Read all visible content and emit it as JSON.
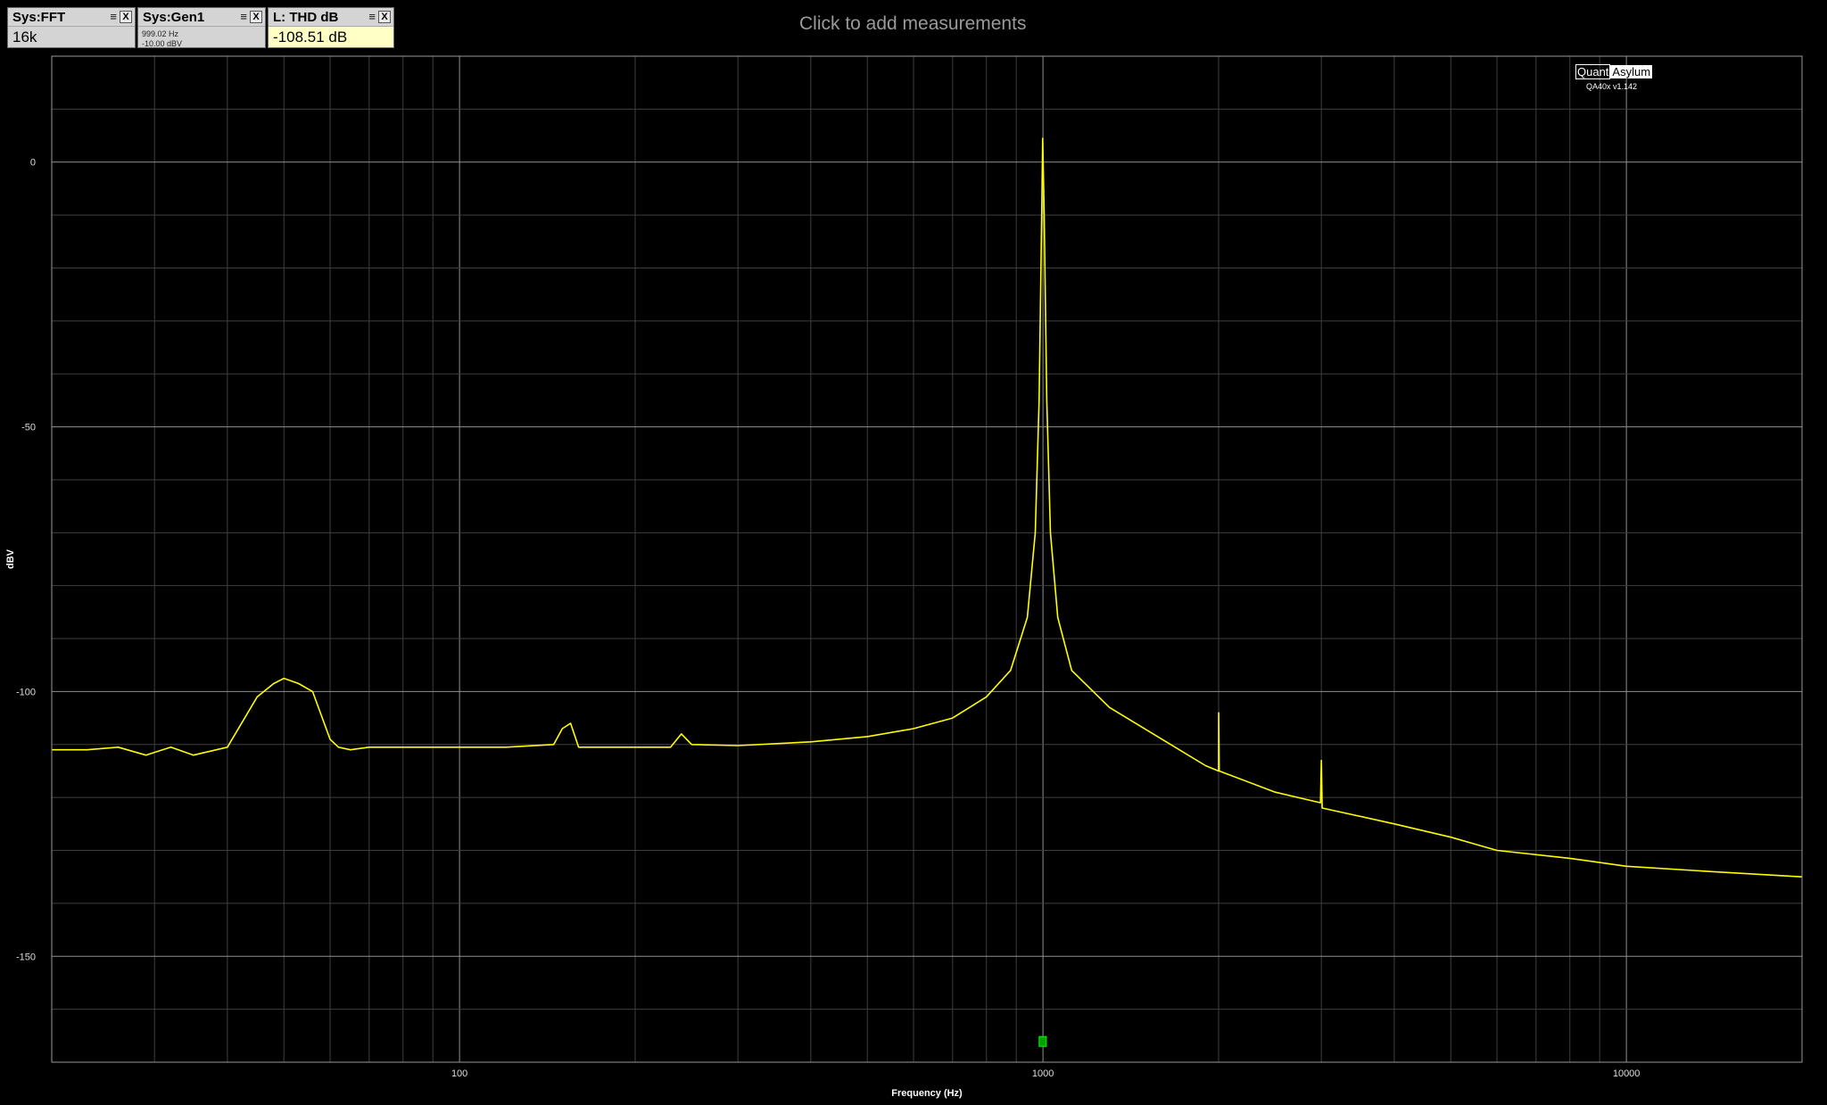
{
  "widgets": [
    {
      "title": "Sys:FFT",
      "value": "16k",
      "lines": [],
      "menu_icon": "hamburger-icon",
      "close_label": "X"
    },
    {
      "title": "Sys:Gen1",
      "value": "",
      "lines": [
        "999.02 Hz",
        "-10.00 dBV"
      ],
      "menu_icon": "hamburger-icon",
      "close_label": "X"
    },
    {
      "title": "L: THD dB",
      "value": "-108.51 dB",
      "lines": [],
      "menu_icon": "hamburger-icon",
      "close_label": "X"
    }
  ],
  "add_measurements": "Click to add measurements",
  "logo": {
    "part1": "Quant",
    "part2": "Asylum",
    "version": "QA40x v1.142"
  },
  "colors": {
    "trace": "#ffff00",
    "grid": "#3f3f3f",
    "grid_major": "#909090",
    "marker": "#00a000",
    "background": "#000000"
  },
  "chart_data": {
    "type": "line",
    "title": "",
    "xlabel": "Frequency (Hz)",
    "ylabel": "dBV",
    "x_scale": "log",
    "xlim": [
      20,
      20000
    ],
    "ylim": [
      -170,
      20
    ],
    "x_ticks": [
      100,
      1000,
      10000
    ],
    "x_tick_labels": [
      "100",
      "1000",
      "10000"
    ],
    "y_ticks": [
      0,
      -50,
      -100,
      -150
    ],
    "y_tick_labels": [
      "0",
      "-50",
      "-100",
      "-150"
    ],
    "grid": true,
    "series": [
      {
        "color": "#ffff00",
        "points": [
          [
            20,
            -111
          ],
          [
            23,
            -111
          ],
          [
            26,
            -110.5
          ],
          [
            29,
            -112
          ],
          [
            32,
            -110.5
          ],
          [
            35,
            -112
          ],
          [
            40,
            -110.5
          ],
          [
            45,
            -101
          ],
          [
            48,
            -98.5
          ],
          [
            50,
            -97.5
          ],
          [
            53,
            -98.5
          ],
          [
            56,
            -100
          ],
          [
            60,
            -109
          ],
          [
            62,
            -110.5
          ],
          [
            65,
            -111
          ],
          [
            70,
            -110.5
          ],
          [
            80,
            -110.5
          ],
          [
            90,
            -110.5
          ],
          [
            100,
            -110.5
          ],
          [
            120,
            -110.5
          ],
          [
            145,
            -110
          ],
          [
            150,
            -107
          ],
          [
            155,
            -106
          ],
          [
            160,
            -110.5
          ],
          [
            200,
            -110.5
          ],
          [
            230,
            -110.5
          ],
          [
            240,
            -108
          ],
          [
            250,
            -110
          ],
          [
            300,
            -110.2
          ],
          [
            400,
            -109.5
          ],
          [
            500,
            -108.5
          ],
          [
            600,
            -107
          ],
          [
            700,
            -105
          ],
          [
            800,
            -101
          ],
          [
            880,
            -96
          ],
          [
            940,
            -86
          ],
          [
            970,
            -70
          ],
          [
            985,
            -45
          ],
          [
            995,
            -10
          ],
          [
            999.02,
            4.5
          ],
          [
            1005,
            -10
          ],
          [
            1015,
            -45
          ],
          [
            1030,
            -70
          ],
          [
            1060,
            -86
          ],
          [
            1120,
            -96
          ],
          [
            1300,
            -103
          ],
          [
            1600,
            -109
          ],
          [
            1900,
            -114
          ],
          [
            2000,
            -115
          ],
          [
            2001,
            -104
          ],
          [
            2005,
            -115
          ],
          [
            2500,
            -119
          ],
          [
            2990,
            -121
          ],
          [
            3000,
            -113
          ],
          [
            3010,
            -122
          ],
          [
            4000,
            -125
          ],
          [
            5000,
            -127.5
          ],
          [
            6000,
            -130
          ],
          [
            8000,
            -131.5
          ],
          [
            10000,
            -133
          ],
          [
            14000,
            -134
          ],
          [
            20000,
            -135
          ]
        ]
      }
    ],
    "marker": {
      "x": 999.02,
      "y": -166
    }
  }
}
